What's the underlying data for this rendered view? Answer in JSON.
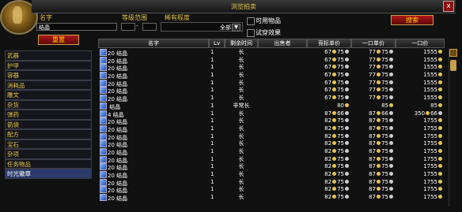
{
  "window": {
    "title": "浏览拍卖",
    "close": "x"
  },
  "filters": {
    "name_label": "名字",
    "name_value": "结晶",
    "level_label": "等级范围",
    "level_sep": "-",
    "rarity_label": "稀有程度",
    "rarity_value": "全部",
    "usable_label": "可用物品",
    "preview_label": "试穿效果",
    "reset_button": "重置",
    "search_button": "搜索"
  },
  "categories": [
    "武器",
    "护甲",
    "容器",
    "消耗品",
    "雕文",
    "杂货",
    "弹药",
    "箭袋",
    "配方",
    "宝石",
    "杂项",
    "任务物品",
    "时光徽章"
  ],
  "selected_category": "时光徽章",
  "columns": {
    "name": "名字",
    "lv": "Lv",
    "time": "剩余时间",
    "seller": "出售者",
    "bid": "竞标单价",
    "buyout_each": "一口单价",
    "buyout": "一口价"
  },
  "rows": [
    {
      "count": "20",
      "name": "结晶",
      "lv": "1",
      "time": "长",
      "bid_g": "67",
      "bid_s": "75",
      "each_g": "77",
      "each_s": "75",
      "buy_g": "1555"
    },
    {
      "count": "20",
      "name": "结晶",
      "lv": "1",
      "time": "长",
      "bid_g": "67",
      "bid_s": "75",
      "each_g": "77",
      "each_s": "75",
      "buy_g": "1555"
    },
    {
      "count": "20",
      "name": "结晶",
      "lv": "1",
      "time": "长",
      "bid_g": "67",
      "bid_s": "75",
      "each_g": "77",
      "each_s": "75",
      "buy_g": "1555"
    },
    {
      "count": "20",
      "name": "结晶",
      "lv": "1",
      "time": "长",
      "bid_g": "67",
      "bid_s": "75",
      "each_g": "77",
      "each_s": "75",
      "buy_g": "1555"
    },
    {
      "count": "20",
      "name": "结晶",
      "lv": "1",
      "time": "长",
      "bid_g": "67",
      "bid_s": "75",
      "each_g": "77",
      "each_s": "75",
      "buy_g": "1555"
    },
    {
      "count": "20",
      "name": "结晶",
      "lv": "1",
      "time": "长",
      "bid_g": "67",
      "bid_s": "75",
      "each_g": "77",
      "each_s": "75",
      "buy_g": "1555"
    },
    {
      "count": "20",
      "name": "结晶",
      "lv": "1",
      "time": "长",
      "bid_g": "67",
      "bid_s": "75",
      "each_g": "77",
      "each_s": "75",
      "buy_g": "1555"
    },
    {
      "count": "",
      "name": "结晶",
      "lv": "1",
      "time": "非常长",
      "bid_g": "80",
      "bid_s": "",
      "each_g": "85",
      "each_s": "",
      "buy_g": "85"
    },
    {
      "count": "4",
      "name": "结晶",
      "lv": "1",
      "time": "长",
      "bid_g": "87",
      "bid_s": "66",
      "each_g": "87",
      "each_s": "66",
      "buy_g": "350",
      "buy_s": "66"
    },
    {
      "count": "20",
      "name": "结晶",
      "lv": "1",
      "time": "长",
      "bid_g": "82",
      "bid_s": "75",
      "each_g": "87",
      "each_s": "75",
      "buy_g": "1755"
    },
    {
      "count": "20",
      "name": "结晶",
      "lv": "1",
      "time": "长",
      "bid_g": "82",
      "bid_s": "75",
      "each_g": "87",
      "each_s": "75",
      "buy_g": "1755"
    },
    {
      "count": "20",
      "name": "结晶",
      "lv": "1",
      "time": "长",
      "bid_g": "82",
      "bid_s": "75",
      "each_g": "87",
      "each_s": "75",
      "buy_g": "1755"
    },
    {
      "count": "20",
      "name": "结晶",
      "lv": "1",
      "time": "长",
      "bid_g": "82",
      "bid_s": "75",
      "each_g": "87",
      "each_s": "75",
      "buy_g": "1755"
    },
    {
      "count": "20",
      "name": "结晶",
      "lv": "1",
      "time": "长",
      "bid_g": "82",
      "bid_s": "75",
      "each_g": "87",
      "each_s": "75",
      "buy_g": "1755"
    },
    {
      "count": "20",
      "name": "结晶",
      "lv": "1",
      "time": "长",
      "bid_g": "82",
      "bid_s": "75",
      "each_g": "87",
      "each_s": "75",
      "buy_g": "1755"
    },
    {
      "count": "20",
      "name": "结晶",
      "lv": "1",
      "time": "长",
      "bid_g": "82",
      "bid_s": "75",
      "each_g": "87",
      "each_s": "75",
      "buy_g": "1755"
    },
    {
      "count": "20",
      "name": "结晶",
      "lv": "1",
      "time": "长",
      "bid_g": "82",
      "bid_s": "75",
      "each_g": "87",
      "each_s": "75",
      "buy_g": "1755"
    },
    {
      "count": "20",
      "name": "结晶",
      "lv": "1",
      "time": "长",
      "bid_g": "82",
      "bid_s": "75",
      "each_g": "87",
      "each_s": "75",
      "buy_g": "1755"
    },
    {
      "count": "20",
      "name": "结晶",
      "lv": "1",
      "time": "长",
      "bid_g": "82",
      "bid_s": "75",
      "each_g": "87",
      "each_s": "75",
      "buy_g": "1755"
    },
    {
      "count": "20",
      "name": "结晶",
      "lv": "1",
      "time": "长",
      "bid_g": "82",
      "bid_s": "75",
      "each_g": "87",
      "each_s": "75",
      "buy_g": "1755"
    }
  ],
  "colors": {
    "accent_gold": "#e8c34a",
    "button_red": "#8a1010",
    "selected_bg": "#2a3a6a"
  }
}
